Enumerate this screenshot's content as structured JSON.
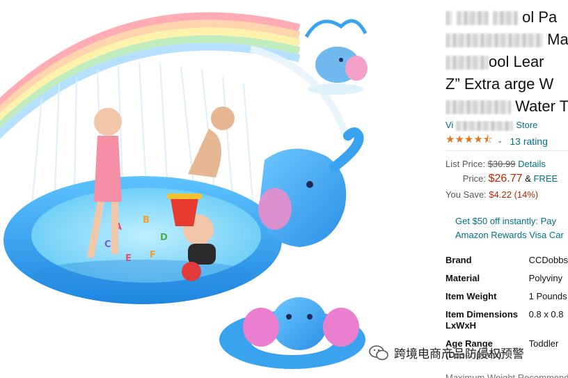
{
  "product": {
    "title_lines": [
      "ol Pa",
      "Ma",
      "ool Lear",
      "Z” Extra  arge W",
      "Water T"
    ],
    "store_link": "Store",
    "store_prefix": "Vi",
    "rating_count": "13 rating",
    "list_price_label": "List Price:",
    "list_price": "$30.99",
    "details_link": "Details",
    "price_label": "Price:",
    "price": "$26.77",
    "amp": "&",
    "free_label": "FREE",
    "you_save_label": "You Save:",
    "you_save": "$4.22 (14%)",
    "promo_line1": "Get $50 off instantly: Pay",
    "promo_line2": "Amazon Rewards Visa Car"
  },
  "rating": {
    "value_fraction": 0.9,
    "stars_text": "★★★★⯪"
  },
  "specs": [
    {
      "key": "Brand",
      "value": "CCDobbs"
    },
    {
      "key": "Material",
      "value": "Polyviny"
    },
    {
      "key": "Item Weight",
      "value": "1 Pounds"
    },
    {
      "key": "Item Dimensions LxWxH",
      "value": "0.8 x 0.8"
    },
    {
      "key": "Age Range (Description)",
      "value": "Toddler"
    }
  ],
  "cut_row": "Maximum Weight Recommendation",
  "watermark": "跨境电商产品防侵权预警",
  "colors": {
    "link": "#007185",
    "price_red": "#b12704",
    "star": "#de7921",
    "pool_blue": "#3aa3f0"
  }
}
